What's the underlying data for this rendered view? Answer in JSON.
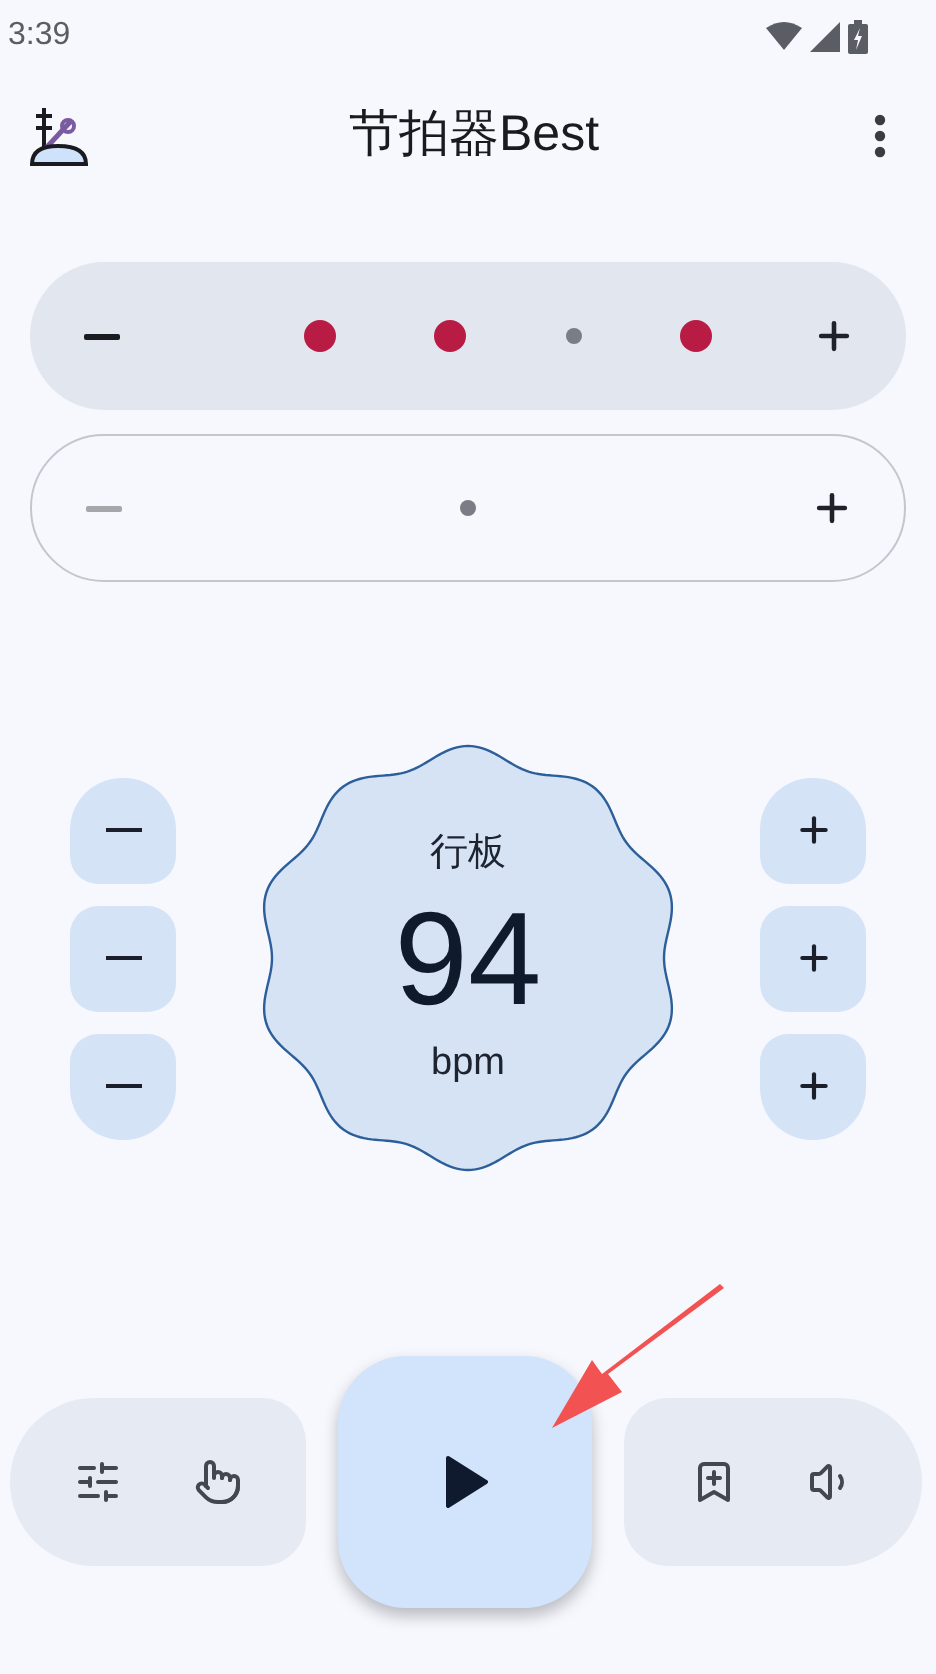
{
  "status_bar": {
    "time": "3:39"
  },
  "app_bar": {
    "title": "节拍器Best"
  },
  "beats": {
    "decrease_disabled": false,
    "items": [
      {
        "kind": "accent"
      },
      {
        "kind": "accent"
      },
      {
        "kind": "muted"
      },
      {
        "kind": "accent"
      }
    ]
  },
  "subdivisions": {
    "decrease_disabled": true,
    "items": [
      {
        "kind": "muted"
      }
    ]
  },
  "tempo": {
    "marking": "行板",
    "bpm": "94",
    "unit": "bpm"
  },
  "playback": {
    "playing": false
  }
}
